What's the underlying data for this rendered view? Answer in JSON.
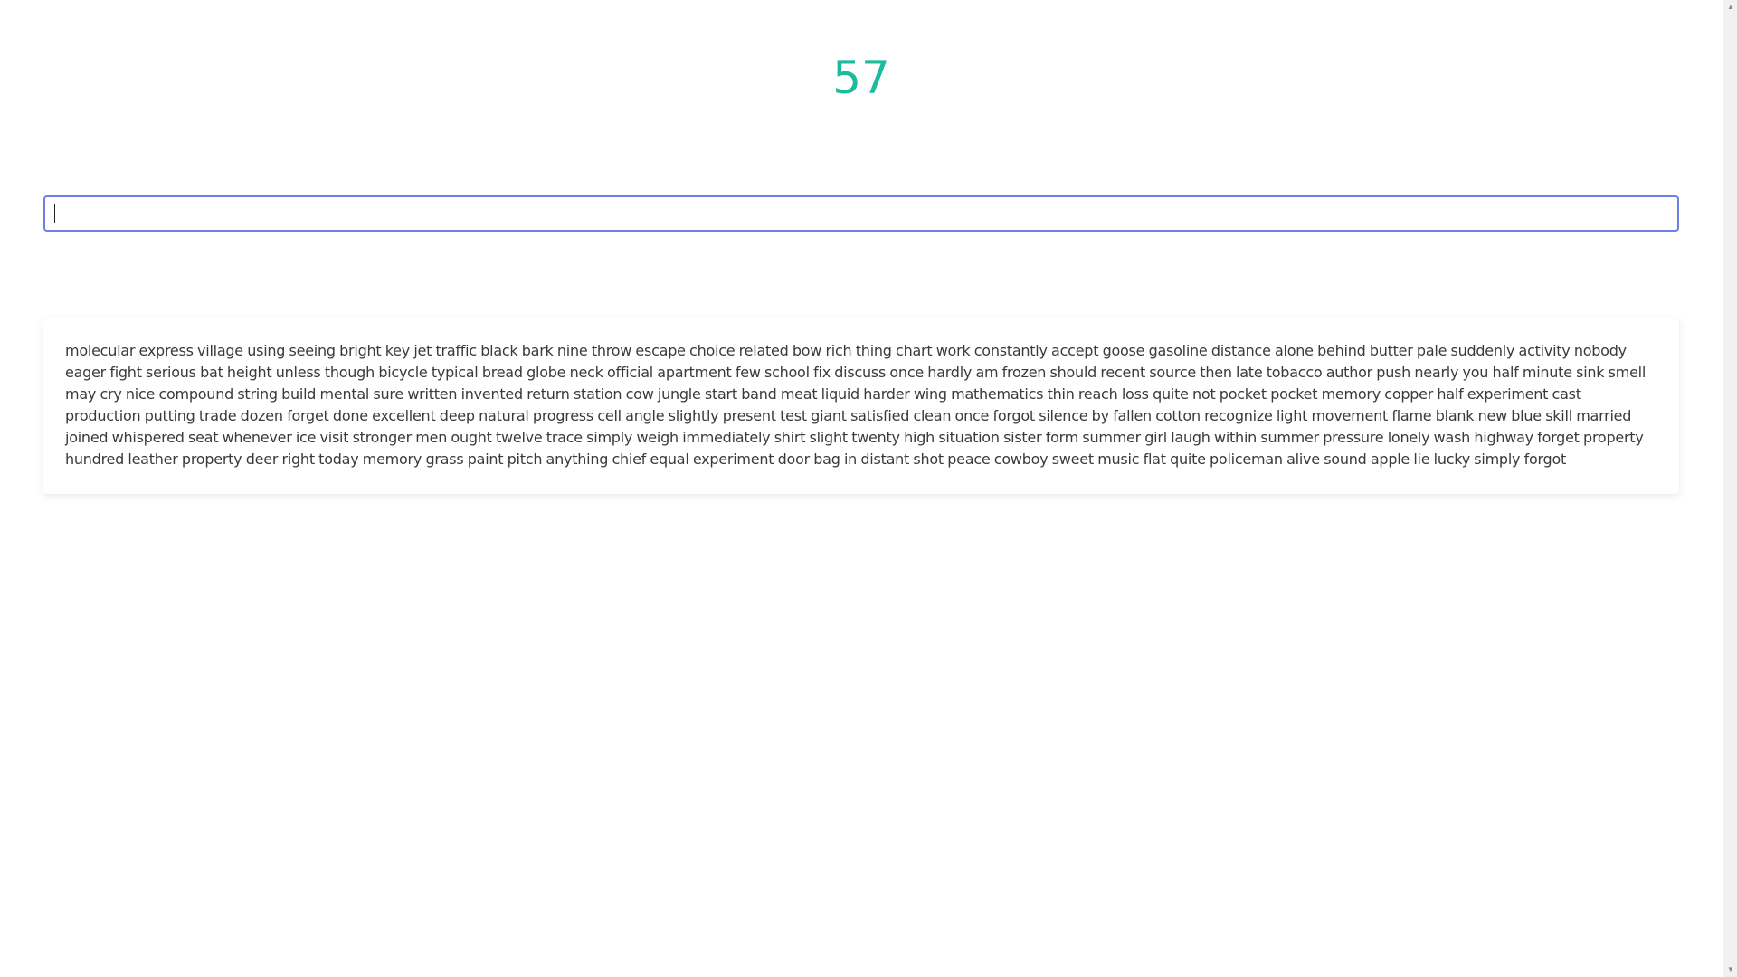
{
  "timer": {
    "value": "57",
    "color": "#1abc9c"
  },
  "typing_input": {
    "value": "",
    "placeholder": ""
  },
  "words": {
    "text": "molecular express village using seeing bright key jet traffic black bark nine throw escape choice related bow rich thing chart work constantly accept goose gasoline distance alone behind butter pale suddenly activity nobody eager fight serious bat height unless though bicycle typical bread globe neck official apartment few school fix discuss once hardly am frozen should recent source then late tobacco author push nearly you half minute sink smell may cry nice compound string build mental sure written invented return station cow jungle start band meat liquid harder wing mathematics thin reach loss quite not pocket pocket memory copper half experiment cast production putting trade dozen forget done excellent deep natural progress cell angle slightly present test giant satisfied clean once forgot silence by fallen cotton recognize light movement flame blank new blue skill married joined whispered seat whenever ice visit stronger men ought twelve trace simply weigh immediately shirt slight twenty high situation sister form summer girl laugh within summer pressure lonely wash highway forget property hundred leather property deer right today memory grass paint pitch anything chief equal experiment door bag in distant shot peace cowboy sweet music flat quite policeman alive sound apple lie lucky simply forgot"
  },
  "scrollbar": {
    "up_icon": "triangle-up-icon",
    "down_icon": "triangle-down-icon",
    "up_glyph": "▲",
    "down_glyph": "▼"
  }
}
